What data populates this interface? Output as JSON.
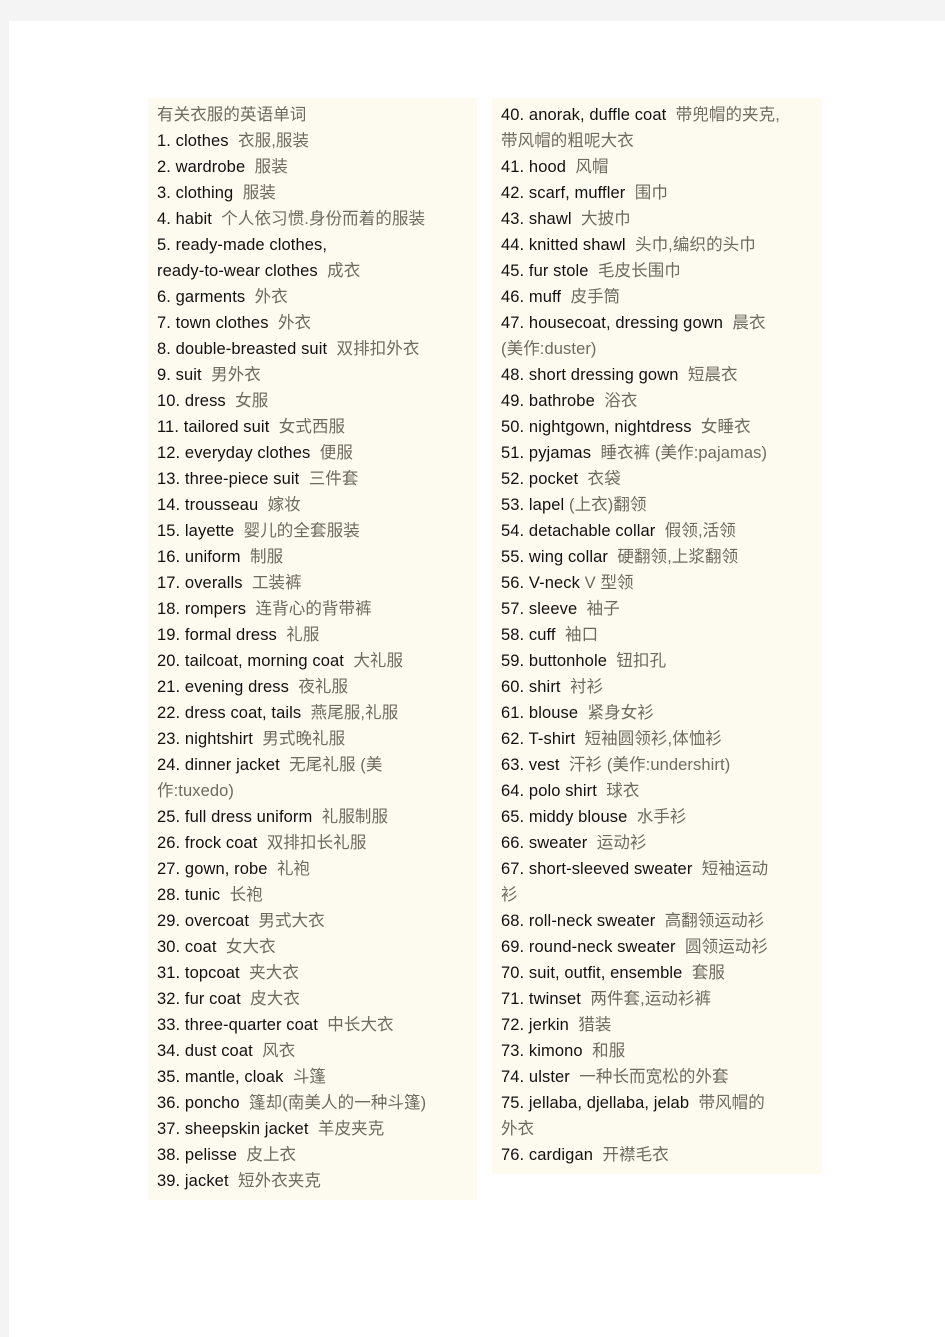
{
  "document": {
    "title": "有关衣服的英语单词",
    "columns": [
      {
        "name": "left",
        "lines": [
          {
            "en": "1. clothes  ",
            "cn": "衣服,服装"
          },
          {
            "en": "2. wardrobe  ",
            "cn": "服装"
          },
          {
            "en": "3. clothing  ",
            "cn": "服装"
          },
          {
            "en": "4. habit  ",
            "cn": "个人依习惯.身份而着的服装"
          },
          {
            "en": "5. ready-made clothes,",
            "cn": ""
          },
          {
            "en": "ready-to-wear clothes  ",
            "cn": "成衣"
          },
          {
            "en": "6. garments  ",
            "cn": "外衣"
          },
          {
            "en": "7. town clothes  ",
            "cn": "外衣"
          },
          {
            "en": "8. double-breasted suit  ",
            "cn": "双排扣外衣"
          },
          {
            "en": "9. suit  ",
            "cn": "男外衣"
          },
          {
            "en": "10. dress  ",
            "cn": "女服"
          },
          {
            "en": "11. tailored suit  ",
            "cn": "女式西服"
          },
          {
            "en": "12. everyday clothes  ",
            "cn": "便服"
          },
          {
            "en": "13. three-piece suit  ",
            "cn": "三件套"
          },
          {
            "en": "14. trousseau  ",
            "cn": "嫁妆"
          },
          {
            "en": "15. layette  ",
            "cn": "婴儿的全套服装"
          },
          {
            "en": "16. uniform  ",
            "cn": "制服"
          },
          {
            "en": "17. overalls  ",
            "cn": "工装裤"
          },
          {
            "en": "18. rompers  ",
            "cn": "连背心的背带裤"
          },
          {
            "en": "19. formal dress  ",
            "cn": "礼服"
          },
          {
            "en": "20. tailcoat, morning coat  ",
            "cn": "大礼服"
          },
          {
            "en": "21. evening dress  ",
            "cn": "夜礼服"
          },
          {
            "en": "22. dress coat, tails  ",
            "cn": "燕尾服,礼服"
          },
          {
            "en": "23. nightshirt  ",
            "cn": "男式晚礼服"
          },
          {
            "en": "24. dinner jacket  ",
            "cn": "无尾礼服 (美"
          },
          {
            "en": "",
            "cn": "作:tuxedo)"
          },
          {
            "en": "25. full dress uniform  ",
            "cn": "礼服制服"
          },
          {
            "en": "26. frock coat  ",
            "cn": "双排扣长礼服"
          },
          {
            "en": "27. gown, robe  ",
            "cn": "礼袍"
          },
          {
            "en": "28. tunic  ",
            "cn": "长袍"
          },
          {
            "en": "29. overcoat  ",
            "cn": "男式大衣"
          },
          {
            "en": "30. coat  ",
            "cn": "女大衣"
          },
          {
            "en": "31. topcoat  ",
            "cn": "夹大衣"
          },
          {
            "en": "32. fur coat  ",
            "cn": "皮大衣"
          },
          {
            "en": "33. three-quarter coat  ",
            "cn": "中长大衣"
          },
          {
            "en": "34. dust coat  ",
            "cn": "风衣"
          },
          {
            "en": "35. mantle, cloak  ",
            "cn": "斗篷"
          },
          {
            "en": "36. poncho  ",
            "cn": "篷却(南美人的一种斗篷)"
          },
          {
            "en": "37. sheepskin jacket  ",
            "cn": "羊皮夹克"
          },
          {
            "en": "38. pelisse  ",
            "cn": "皮上衣"
          },
          {
            "en": "39. jacket  ",
            "cn": "短外衣夹克"
          }
        ]
      },
      {
        "name": "right",
        "lines": [
          {
            "en": "40. anorak, duffle coat  ",
            "cn": "带兜帽的夹克,"
          },
          {
            "en": "",
            "cn": "带风帽的粗呢大衣"
          },
          {
            "en": "41. hood  ",
            "cn": "风帽"
          },
          {
            "en": "42. scarf, muffler  ",
            "cn": "围巾"
          },
          {
            "en": "43. shawl  ",
            "cn": "大披巾"
          },
          {
            "en": "44. knitted shawl  ",
            "cn": "头巾,编织的头巾"
          },
          {
            "en": "45. fur stole  ",
            "cn": "毛皮长围巾"
          },
          {
            "en": "46. muff  ",
            "cn": "皮手筒"
          },
          {
            "en": "47. housecoat, dressing gown  ",
            "cn": "晨衣"
          },
          {
            "en": "",
            "cn": "(美作:duster)"
          },
          {
            "en": "48. short dressing gown  ",
            "cn": "短晨衣"
          },
          {
            "en": "49. bathrobe  ",
            "cn": "浴衣"
          },
          {
            "en": "50. nightgown, nightdress  ",
            "cn": "女睡衣"
          },
          {
            "en": "51. pyjamas  ",
            "cn": "睡衣裤 (美作:pajamas)"
          },
          {
            "en": "52. pocket  ",
            "cn": "衣袋"
          },
          {
            "en": "53. lapel ",
            "cn": "(上衣)翻领"
          },
          {
            "en": "54. detachable collar  ",
            "cn": "假领,活领"
          },
          {
            "en": "55. wing collar  ",
            "cn": "硬翻领,上浆翻领"
          },
          {
            "en": "56. V-neck ",
            "cn": "V 型领"
          },
          {
            "en": "57. sleeve  ",
            "cn": "袖子"
          },
          {
            "en": "58. cuff  ",
            "cn": "袖口"
          },
          {
            "en": "59. buttonhole  ",
            "cn": "钮扣孔"
          },
          {
            "en": "60. shirt  ",
            "cn": "衬衫"
          },
          {
            "en": "61. blouse  ",
            "cn": "紧身女衫"
          },
          {
            "en": "62. T-shirt  ",
            "cn": "短袖圆领衫,体恤衫"
          },
          {
            "en": "63. vest  ",
            "cn": "汗衫 (美作:undershirt)"
          },
          {
            "en": "64. polo shirt  ",
            "cn": "球衣"
          },
          {
            "en": "65. middy blouse  ",
            "cn": "水手衫"
          },
          {
            "en": "66. sweater  ",
            "cn": "运动衫"
          },
          {
            "en": "67. short-sleeved sweater  ",
            "cn": "短袖运动"
          },
          {
            "en": "",
            "cn": "衫"
          },
          {
            "en": "68. roll-neck sweater  ",
            "cn": "高翻领运动衫"
          },
          {
            "en": "69. round-neck sweater  ",
            "cn": "圆领运动衫"
          },
          {
            "en": "70. suit, outfit, ensemble  ",
            "cn": "套服"
          },
          {
            "en": "71. twinset  ",
            "cn": "两件套,运动衫裤"
          },
          {
            "en": "72. jerkin  ",
            "cn": "猎装"
          },
          {
            "en": "73. kimono  ",
            "cn": "和服"
          },
          {
            "en": "74. ulster  ",
            "cn": "一种长而宽松的外套"
          },
          {
            "en": "75. jellaba, djellaba, jelab  ",
            "cn": "带风帽的"
          },
          {
            "en": "",
            "cn": "外衣"
          },
          {
            "en": "76. cardigan  ",
            "cn": "开襟毛衣"
          }
        ]
      }
    ]
  }
}
